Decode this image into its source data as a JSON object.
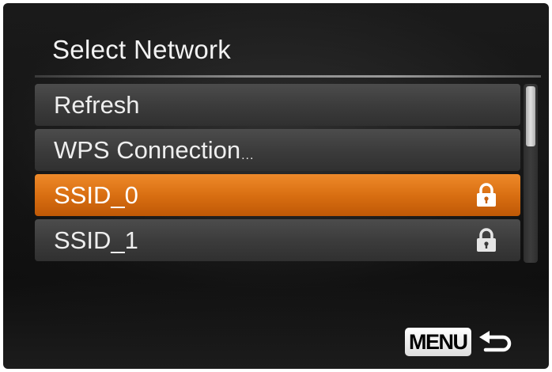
{
  "header": {
    "title": "Select Network"
  },
  "menu": {
    "items": [
      {
        "label": "Refresh",
        "suffix": "",
        "locked": false,
        "selected": false
      },
      {
        "label": "WPS Connection",
        "suffix": "...",
        "locked": false,
        "selected": false
      },
      {
        "label": "SSID_0",
        "suffix": "",
        "locked": true,
        "selected": true,
        "icon": "lock-icon"
      },
      {
        "label": "SSID_1",
        "suffix": "",
        "locked": true,
        "selected": false,
        "icon": "lock-icon"
      }
    ]
  },
  "footer": {
    "menu_button_label": "MENU",
    "back_icon": "return-arrow-icon"
  },
  "colors": {
    "highlight": "#d96f12",
    "item_background": "#3c3c3c",
    "screen_background": "#111111",
    "text": "#eeeeee"
  }
}
